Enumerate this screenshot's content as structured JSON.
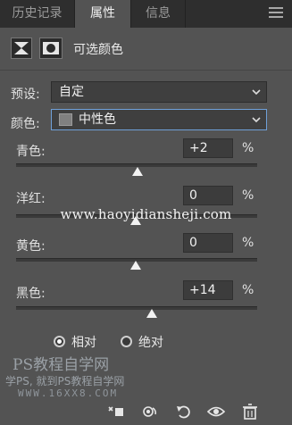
{
  "tabs": [
    {
      "label": "历史记录"
    },
    {
      "label": "属性"
    },
    {
      "label": "信息"
    }
  ],
  "header": {
    "title": "可选颜色"
  },
  "preset": {
    "label": "预设:",
    "value": "自定"
  },
  "colors": {
    "label": "颜色:",
    "value": "中性色",
    "swatch_color": "#808080"
  },
  "sliders": [
    {
      "label": "青色:",
      "value": "+2",
      "unit": "%"
    },
    {
      "label": "洋红:",
      "value": "0",
      "unit": "%"
    },
    {
      "label": "黄色:",
      "value": "0",
      "unit": "%"
    },
    {
      "label": "黑色:",
      "value": "+14",
      "unit": "%"
    }
  ],
  "method": {
    "options": [
      {
        "label": "相对",
        "selected": true
      },
      {
        "label": "绝对",
        "selected": false
      }
    ]
  },
  "watermarks": {
    "url": "www.haoyidiansheji.com",
    "brand": "PS教程自学网",
    "slogan": "学PS, 就到PS教程自学网",
    "site": "WWW.16XX8.COM"
  },
  "accent_color": "#6fa0d8"
}
